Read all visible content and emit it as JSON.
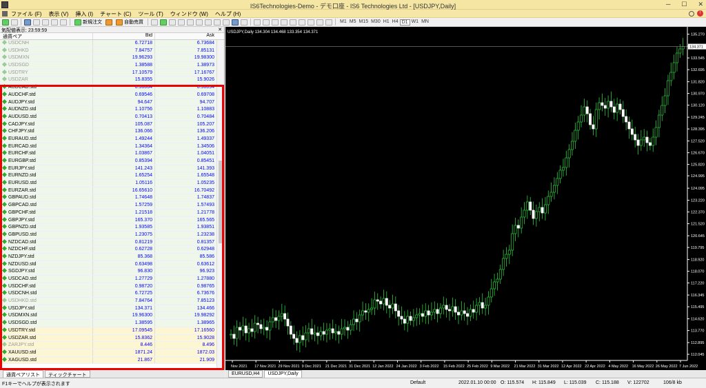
{
  "window": {
    "title": "IS6Technologies-Demo - デモ口座 - IS6 Technologies Ltd - [USDJPY,Daily]"
  },
  "menu": [
    "ファイル (F)",
    "表示 (V)",
    "挿入 (I)",
    "チャート (C)",
    "ツール (T)",
    "ウィンドウ (W)",
    "ヘルプ (H)"
  ],
  "toolbar": {
    "new_order": "新規注文",
    "auto_trade": "自動売買",
    "timeframes": [
      "M1",
      "M5",
      "M15",
      "M30",
      "H1",
      "H4",
      "D1",
      "W1",
      "MN"
    ],
    "active_tf": "D1"
  },
  "market_watch": {
    "title": "気配値表示: 23:59:59",
    "col_symbol": "通貨ペア",
    "col_bid": "Bid",
    "col_ask": "Ask",
    "rows": [
      {
        "s": "USDCNH",
        "b": "6.72718",
        "a": "6.73684",
        "dim": true,
        "bg": "g"
      },
      {
        "s": "USDHKD",
        "b": "7.84757",
        "a": "7.85131",
        "dim": true,
        "bg": "g"
      },
      {
        "s": "USDMXN",
        "b": "19.96293",
        "a": "19.98300",
        "dim": true,
        "bg": "g"
      },
      {
        "s": "USDSGD",
        "b": "1.38588",
        "a": "1.38973",
        "dim": true,
        "bg": "g"
      },
      {
        "s": "USDTRY",
        "b": "17.10579",
        "a": "17.16767",
        "dim": true,
        "bg": "g"
      },
      {
        "s": "USDZAR",
        "b": "15.8355",
        "a": "15.9026",
        "dim": true,
        "bg": "g"
      },
      {
        "s": "AUDCAD.std",
        "b": "0.90004",
        "a": "0.90094",
        "dim": false,
        "bg": "g"
      },
      {
        "s": "AUDCHF.std",
        "b": "0.69546",
        "a": "0.69708",
        "dim": false,
        "bg": "g"
      },
      {
        "s": "AUDJPY.std",
        "b": "94.647",
        "a": "94.707",
        "dim": false,
        "bg": "g"
      },
      {
        "s": "AUDNZD.std",
        "b": "1.10756",
        "a": "1.10883",
        "dim": false,
        "bg": "g"
      },
      {
        "s": "AUDUSD.std",
        "b": "0.70413",
        "a": "0.70484",
        "dim": false,
        "bg": "g"
      },
      {
        "s": "CADJPY.std",
        "b": "105.087",
        "a": "105.207",
        "dim": false,
        "bg": "g"
      },
      {
        "s": "CHFJPY.std",
        "b": "136.066",
        "a": "136.206",
        "dim": false,
        "bg": "g"
      },
      {
        "s": "EURAUD.std",
        "b": "1.49244",
        "a": "1.49337",
        "dim": false,
        "bg": "g"
      },
      {
        "s": "EURCAD.std",
        "b": "1.34364",
        "a": "1.34506",
        "dim": false,
        "bg": "g"
      },
      {
        "s": "EURCHF.std",
        "b": "1.03867",
        "a": "1.04051",
        "dim": false,
        "bg": "g"
      },
      {
        "s": "EURGBP.std",
        "b": "0.85394",
        "a": "0.85451",
        "dim": false,
        "bg": "g"
      },
      {
        "s": "EURJPY.std",
        "b": "141.243",
        "a": "141.393",
        "dim": false,
        "bg": "g"
      },
      {
        "s": "EURNZD.std",
        "b": "1.65254",
        "a": "1.65548",
        "dim": false,
        "bg": "g"
      },
      {
        "s": "EURUSD.std",
        "b": "1.05116",
        "a": "1.05235",
        "dim": false,
        "bg": "g"
      },
      {
        "s": "EURZAR.std",
        "b": "16.65610",
        "a": "16.70492",
        "dim": false,
        "bg": "g"
      },
      {
        "s": "GBPAUD.std",
        "b": "1.74648",
        "a": "1.74837",
        "dim": false,
        "bg": "g"
      },
      {
        "s": "GBPCAD.std",
        "b": "1.57259",
        "a": "1.57493",
        "dim": false,
        "bg": "g"
      },
      {
        "s": "GBPCHF.std",
        "b": "1.21518",
        "a": "1.21778",
        "dim": false,
        "bg": "g"
      },
      {
        "s": "GBPJPY.std",
        "b": "165.370",
        "a": "165.565",
        "dim": false,
        "bg": "g"
      },
      {
        "s": "GBPNZD.std",
        "b": "1.93585",
        "a": "1.93851",
        "dim": false,
        "bg": "g"
      },
      {
        "s": "GBPUSD.std",
        "b": "1.23075",
        "a": "1.23238",
        "dim": false,
        "bg": "g"
      },
      {
        "s": "NZDCAD.std",
        "b": "0.81219",
        "a": "0.81357",
        "dim": false,
        "bg": "g"
      },
      {
        "s": "NZDCHF.std",
        "b": "0.62728",
        "a": "0.62948",
        "dim": false,
        "bg": "g"
      },
      {
        "s": "NZDJPY.std",
        "b": "85.368",
        "a": "85.586",
        "dim": false,
        "bg": "g"
      },
      {
        "s": "NZDUSD.std",
        "b": "0.63498",
        "a": "0.63612",
        "dim": false,
        "bg": "g"
      },
      {
        "s": "SGDJPY.std",
        "b": "96.830",
        "a": "96.923",
        "dim": false,
        "bg": "g"
      },
      {
        "s": "USDCAD.std",
        "b": "1.27729",
        "a": "1.27880",
        "dim": false,
        "bg": "g"
      },
      {
        "s": "USDCHF.std",
        "b": "0.98720",
        "a": "0.98765",
        "dim": false,
        "bg": "g"
      },
      {
        "s": "USDCNH.std",
        "b": "6.72725",
        "a": "6.73676",
        "dim": false,
        "bg": "g"
      },
      {
        "s": "USDHKD.std",
        "b": "7.84764",
        "a": "7.85123",
        "dim": true,
        "bg": "g"
      },
      {
        "s": "USDJPY.std",
        "b": "134.371",
        "a": "134.466",
        "dim": false,
        "bg": "g"
      },
      {
        "s": "USDMXN.std",
        "b": "19.96300",
        "a": "19.98292",
        "dim": false,
        "bg": "g"
      },
      {
        "s": "USDSGD.std",
        "b": "1.38595",
        "a": "1.38965",
        "dim": false,
        "bg": "g"
      },
      {
        "s": "USDTRY.std",
        "b": "17.09545",
        "a": "17.16560",
        "dim": false,
        "bg": "y"
      },
      {
        "s": "USDZAR.std",
        "b": "15.8362",
        "a": "15.9028",
        "dim": false,
        "bg": "y"
      },
      {
        "s": "ZARJPY.std",
        "b": "8.446",
        "a": "8.496",
        "dim": true,
        "bg": "y"
      },
      {
        "s": "XAUUSD.std",
        "b": "1871.24",
        "a": "1872.03",
        "dim": false,
        "bg": "y"
      },
      {
        "s": "XAGUSD.std",
        "b": "21.867",
        "a": "21.909",
        "dim": false,
        "bg": "y"
      }
    ],
    "tabs": [
      "通貨ペアリスト",
      "ティックチャート"
    ]
  },
  "chart_tabs": [
    "EURUSD,H4",
    "USDJPY,Daily"
  ],
  "chart_data": {
    "type": "line",
    "title": "USDJPY,Daily 134.304 134.468 133.354 134.371",
    "current_price": "134.371",
    "y_ticks": [
      "135.270",
      "134.395",
      "133.545",
      "132.695",
      "131.820",
      "130.970",
      "130.120",
      "129.245",
      "128.395",
      "127.520",
      "126.670",
      "125.820",
      "124.995",
      "124.095",
      "123.220",
      "122.370",
      "121.520",
      "120.645",
      "119.795",
      "118.920",
      "118.070",
      "117.220",
      "116.345",
      "115.495",
      "114.620",
      "113.770",
      "112.895",
      "112.045"
    ],
    "x_ticks": [
      "Nov 2021",
      "17 Nov 2021",
      "29 Nov 2021",
      "9 Dec 2021",
      "21 Dec 2021",
      "31 Dec 2021",
      "12 Jan 2022",
      "24 Jan 2022",
      "3 Feb 2022",
      "15 Feb 2022",
      "25 Feb 2022",
      "9 Mar 2022",
      "21 Mar 2022",
      "31 Mar 2022",
      "12 Apr 2022",
      "22 Apr 2022",
      "4 May 2022",
      "16 May 2022",
      "26 May 2022",
      "7 Jun 2022"
    ],
    "ylim": [
      111.6,
      135.6
    ],
    "closes": [
      113.5,
      113.2,
      114.0,
      113.8,
      114.1,
      113.6,
      113.9,
      113.7,
      114.3,
      114.2,
      113.9,
      114.0,
      113.8,
      114.4,
      114.7,
      114.5,
      114.8,
      115.0,
      114.6,
      114.1,
      113.5,
      113.2,
      112.9,
      113.4,
      113.1,
      113.6,
      113.9,
      113.5,
      113.6,
      113.4,
      113.7,
      113.5,
      113.8,
      113.9,
      113.6,
      113.7,
      113.5,
      113.9,
      114.0,
      113.8,
      114.2,
      114.6,
      114.4,
      114.9,
      115.2,
      115.1,
      115.3,
      115.4,
      116.0,
      115.9,
      115.7,
      116.1,
      115.6,
      115.4,
      115.7,
      115.2,
      114.8,
      114.6,
      114.3,
      114.8,
      114.5,
      114.7,
      114.9,
      115.0,
      114.8,
      115.2,
      114.9,
      115.1,
      115.3,
      115.0,
      115.4,
      115.6,
      115.3,
      115.2,
      115.5,
      115.1,
      114.9,
      115.2,
      115.0,
      114.8,
      115.3,
      115.1,
      115.6,
      115.8,
      115.4,
      115.6,
      116.2,
      116.8,
      117.3,
      117.5,
      118.2,
      119.0,
      119.3,
      119.6,
      120.8,
      121.4,
      121.2,
      122.0,
      122.5,
      123.1,
      122.5,
      121.9,
      122.4,
      122.7,
      122.3,
      122.9,
      123.5,
      123.8,
      124.3,
      124.8,
      125.4,
      125.6,
      126.3,
      126.9,
      127.5,
      128.3,
      128.9,
      129.4,
      130.0,
      129.5,
      128.7,
      128.4,
      129.8,
      130.3,
      130.1,
      129.9,
      130.4,
      130.0,
      129.6,
      130.2,
      129.8,
      129.3,
      128.9,
      128.4,
      128.0,
      127.6,
      127.2,
      127.6,
      127.8,
      127.4,
      127.2,
      127.8,
      128.5,
      129.4,
      130.1,
      130.8,
      131.9,
      132.5,
      133.2,
      133.9,
      134.2,
      134.371
    ]
  },
  "status": {
    "help": "F1キーでヘルプが表示されます",
    "profile": "Default",
    "datetime": "2022.01.10 00:00",
    "open": "O: 115.574",
    "high": "H: 115.849",
    "low": "L: 115.039",
    "close": "C: 115.188",
    "volume": "V: 122702",
    "traffic": "106/8 kb"
  }
}
